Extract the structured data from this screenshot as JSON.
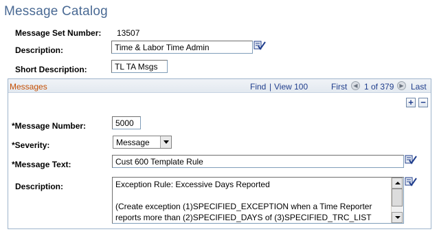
{
  "page": {
    "title": "Message Catalog"
  },
  "header_fields": {
    "message_set_number_label": "Message Set Number:",
    "message_set_number_value": "13507",
    "description_label": "Description:",
    "description_value": "Time & Labor Time Admin",
    "short_description_label": "Short Description:",
    "short_description_value": "TL TA Msgs"
  },
  "messages_panel": {
    "title": "Messages",
    "find_label": "Find",
    "separator": "|",
    "view_label": "View 100",
    "first_label": "First",
    "page_info": "1 of 379",
    "last_label": "Last",
    "add_row_symbol": "+",
    "delete_row_symbol": "−"
  },
  "message_fields": {
    "message_number_label": "*Message Number:",
    "message_number_value": "5000",
    "severity_label": "*Severity:",
    "severity_value": "Message",
    "message_text_label": "*Message Text:",
    "message_text_value": "Cust 600 Template Rule",
    "description_label": "Description:",
    "description_value": "Exception Rule: Excessive Days Reported\n\n(Create exception (1)SPECIFIED_EXCEPTION when a Time Reporter reports more than (2)SPECIFIED_DAYS of (3)SPECIFIED_TRC_LIST"
  },
  "icons": {
    "spell_check": "spell-check-icon",
    "previous": "previous-arrow-icon",
    "next": "next-arrow-icon"
  },
  "colors": {
    "title": "#4a6a94",
    "panel_title": "#c44d00",
    "link": "#1f3d8c",
    "panel_border": "#9eb4cc"
  }
}
